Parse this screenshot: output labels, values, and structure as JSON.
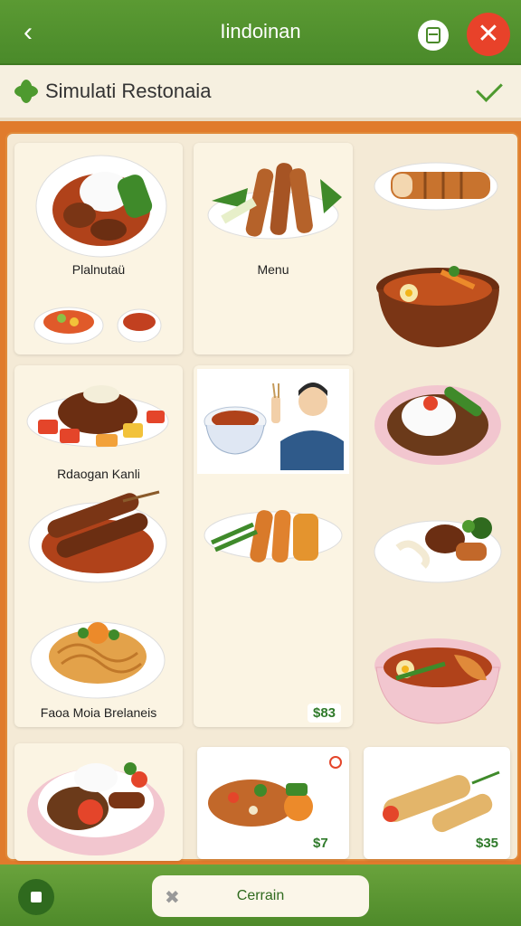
{
  "header": {
    "back_icon": "chevron-left-icon",
    "title": "Iindoinan",
    "menu_icon": "panel-icon",
    "close_icon": "close-icon"
  },
  "subheader": {
    "leaf_icon": "leaf-icon",
    "title": "Simulati Restonaia",
    "check_icon": "check-icon"
  },
  "cards": {
    "c1_label": "Plalnutaü",
    "c2_label": "Menu",
    "c4_label": "Rdaogan Kanli",
    "c7_label": "Faoa Moia Brelaneis",
    "c8_price": "$83",
    "c10_price": "$7",
    "c11_price": "$35"
  },
  "footer": {
    "stop_icon": "stop-icon",
    "confirm_label": "Cerrain",
    "confirm_icon": "tools-icon"
  },
  "colors": {
    "primary_green": "#4a8a2a",
    "accent_orange": "#e07b2c",
    "close_red": "#e8422a",
    "card_bg": "#fbf4e3"
  }
}
